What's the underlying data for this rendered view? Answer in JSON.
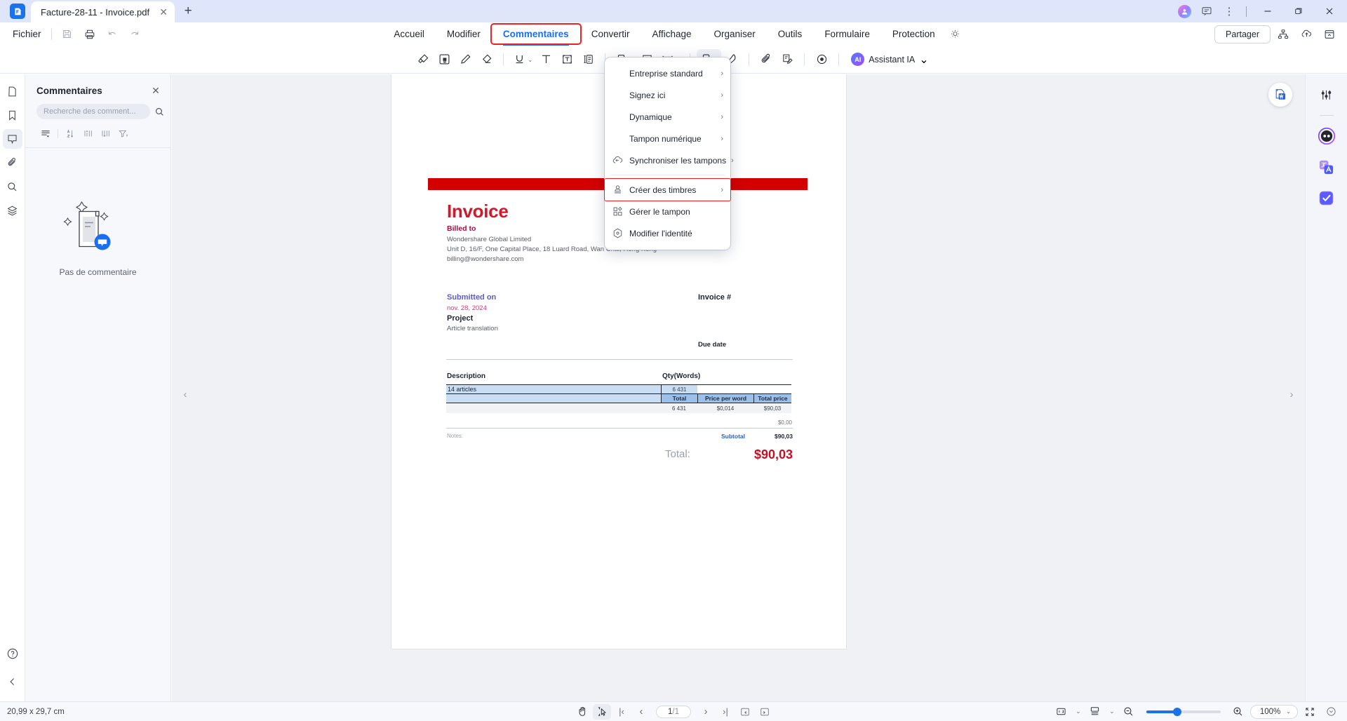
{
  "titlebar": {
    "tab_title": "Facture-28-11 - Invoice.pdf",
    "close_glyph": "✕",
    "new_tab_glyph": "+",
    "minimize_glyph": "—",
    "maximize_glyph": "❐",
    "close_window_glyph": "✕",
    "kebab_glyph": "⋮"
  },
  "menubar": {
    "fichier": "Fichier",
    "tabs": [
      {
        "label": "Accueil",
        "active": false
      },
      {
        "label": "Modifier",
        "active": false
      },
      {
        "label": "Commentaires",
        "active": true
      },
      {
        "label": "Convertir",
        "active": false
      },
      {
        "label": "Affichage",
        "active": false
      },
      {
        "label": "Organiser",
        "active": false
      },
      {
        "label": "Outils",
        "active": false
      },
      {
        "label": "Formulaire",
        "active": false
      },
      {
        "label": "Protection",
        "active": false
      }
    ],
    "share_button": "Partager"
  },
  "toolbar": {
    "ai_label": "Assistant IA",
    "ai_badge": "AI",
    "ai_caret": "⌄",
    "caret": "⌄"
  },
  "panel": {
    "title": "Commentaires",
    "close_glyph": "✕",
    "search_placeholder": "Recherche des comment...",
    "search_value": "",
    "empty_text": "Pas de commentaire"
  },
  "stamp_menu": {
    "items": [
      {
        "label": "Entreprise standard",
        "icon": "none",
        "arrow": "›",
        "highlighted": false
      },
      {
        "label": "Signez ici",
        "icon": "none",
        "arrow": "›",
        "highlighted": false
      },
      {
        "label": "Dynamique",
        "icon": "none",
        "arrow": "›",
        "highlighted": false
      },
      {
        "label": "Tampon numérique",
        "icon": "none",
        "arrow": "›",
        "highlighted": false
      },
      {
        "label": "Synchroniser les tampons",
        "icon": "cloud-sync-icon",
        "arrow": "›",
        "highlighted": false
      },
      {
        "label": "Créer des timbres",
        "icon": "stamp-create-icon",
        "arrow": "›",
        "highlighted": true
      },
      {
        "label": "Gérer le tampon",
        "icon": "manage-stamp-icon",
        "arrow": "",
        "highlighted": false
      },
      {
        "label": "Modifier l'identité",
        "icon": "identity-icon",
        "arrow": "",
        "highlighted": false
      }
    ]
  },
  "document": {
    "title": "Invoice",
    "billed_to_label": "Billed to",
    "company": "Wondershare Global Limited",
    "address": "Unit D, 16/F, One Capital Place, 18 Luard Road, Wan Chai, Hong Kong",
    "email": "billing@wondershare.com",
    "submitted_on_label": "Submitted on",
    "submitted_on_value": "nov. 28, 2024",
    "project_label": "Project",
    "project_value": "Article translation",
    "invoice_label": "Invoice #",
    "due_date_label": "Due date",
    "notes_label": "Notes:",
    "subtotal_label": "Subtotal",
    "subtotal_value": "$90,03",
    "zero_value": "$0,00",
    "total_label": "Total:",
    "total_value": "$90,03",
    "table": {
      "headers": [
        "Description",
        "Qty(Words)"
      ],
      "row_description": "14 articles",
      "row_qty": "6 431",
      "sub_headers": [
        "Total",
        "Price per word",
        "Total price"
      ],
      "sub_values": [
        "6 431",
        "$0,014",
        "$90,03"
      ]
    }
  },
  "status": {
    "page_dimensions": "20,99 x 29,7 cm",
    "page_current": "1",
    "page_total": "/1",
    "zoom_level": "100%",
    "first_glyph": "|‹",
    "prev_glyph": "‹",
    "next_glyph": "›",
    "last_glyph": "›|",
    "minus_glyph": "−",
    "plus_glyph": "+",
    "caret": "⌄"
  }
}
